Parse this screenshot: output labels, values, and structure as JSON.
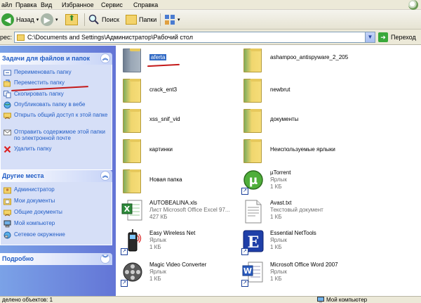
{
  "menu": {
    "items": [
      "айл",
      "Правка",
      "Вид",
      "Избранное",
      "Сервис",
      "Справка"
    ]
  },
  "toolbar": {
    "back_label": "Назад",
    "search_label": "Поиск",
    "folders_label": "Папки"
  },
  "address": {
    "label": "рес:",
    "path": "C:\\Documents and Settings\\Администратор\\Рабочий стол",
    "go_label": "Переход"
  },
  "tasks_panel": {
    "title": "Задачи для файлов и папок",
    "items": [
      {
        "label": "Переименовать папку",
        "icon": "rename-icon"
      },
      {
        "label": "Переместить папку",
        "icon": "move-icon"
      },
      {
        "label": "Скопировать папку",
        "icon": "copy-icon"
      },
      {
        "label": "Опубликовать папку в вебе",
        "icon": "publish-web-icon"
      },
      {
        "label": "Открыть общий доступ к этой папке",
        "icon": "share-icon"
      },
      {
        "label": "Отправить содержимое этой папки по электронной почте",
        "icon": "email-icon"
      },
      {
        "label": "Удалить папку",
        "icon": "delete-icon"
      }
    ]
  },
  "places_panel": {
    "title": "Другие места",
    "items": [
      {
        "label": "Администратор",
        "icon": "user-folder-icon"
      },
      {
        "label": "Мои документы",
        "icon": "my-documents-icon"
      },
      {
        "label": "Общие документы",
        "icon": "shared-documents-icon"
      },
      {
        "label": "Мой компьютер",
        "icon": "my-computer-icon"
      },
      {
        "label": "Сетевое окружение",
        "icon": "network-icon"
      }
    ]
  },
  "details_panel": {
    "title": "Подробно"
  },
  "files": [
    {
      "name": "aferta",
      "line2": "",
      "line3": "",
      "type": "folder",
      "selected": true
    },
    {
      "name": "ashampoo_antispyware_2_205",
      "line2": "",
      "line3": "",
      "type": "folder"
    },
    {
      "name": "crack_ent3",
      "line2": "",
      "line3": "",
      "type": "folder"
    },
    {
      "name": "newbrut",
      "line2": "",
      "line3": "",
      "type": "folder"
    },
    {
      "name": "xss_snif_vid",
      "line2": "",
      "line3": "",
      "type": "folder"
    },
    {
      "name": "документы",
      "line2": "",
      "line3": "",
      "type": "folder"
    },
    {
      "name": "картинки",
      "line2": "",
      "line3": "",
      "type": "folder"
    },
    {
      "name": "Неиспользуемые ярлыки",
      "line2": "",
      "line3": "",
      "type": "folder"
    },
    {
      "name": "Новая папка",
      "line2": "",
      "line3": "",
      "type": "folder"
    },
    {
      "name": "µTorrent",
      "line2": "Ярлык",
      "line3": "1 КБ",
      "type": "utorrent"
    },
    {
      "name": "AUTOBEALINA.xls",
      "line2": "Лист Microsoft Office Excel 97...",
      "line3": "427 КБ",
      "type": "excel"
    },
    {
      "name": "Avast.txt",
      "line2": "Текстовый документ",
      "line3": "1 КБ",
      "type": "text"
    },
    {
      "name": "Easy Wireless Net",
      "line2": "Ярлык",
      "line3": "1 КБ",
      "type": "wireless"
    },
    {
      "name": "Essential NetTools",
      "line2": "Ярлык",
      "line3": "1 КБ",
      "type": "nettools"
    },
    {
      "name": "Magic Video Converter",
      "line2": "Ярлык",
      "line3": "1 КБ",
      "type": "video"
    },
    {
      "name": "Microsoft Office Word 2007",
      "line2": "Ярлык",
      "line3": "1 КБ",
      "type": "word"
    }
  ],
  "status": {
    "left": "делено объектов: 1",
    "right": "Мой компьютер"
  },
  "colors": {
    "task_link": "#215dc6",
    "panel_bg": "#d6dff7",
    "panel_gradient_left": "#7ba2e7",
    "panel_gradient_right": "#6375d6",
    "selection": "#316ac5",
    "annotation_red": "#c41a1a"
  }
}
